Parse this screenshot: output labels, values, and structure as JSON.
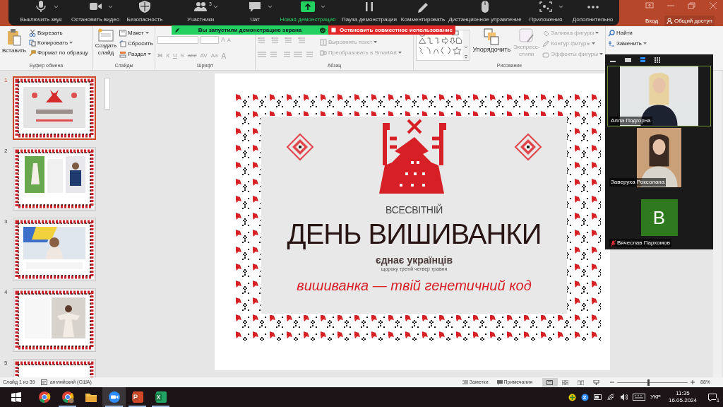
{
  "powerpoint": {
    "sign_in": "Вход",
    "share": "Общий доступ"
  },
  "zoom_toolbar": {
    "items": [
      {
        "label": "Выключить звук",
        "has_menu": true,
        "active": false
      },
      {
        "label": "Остановить видео",
        "has_menu": true,
        "active": false
      },
      {
        "label": "Безопасность",
        "has_menu": false,
        "active": false
      },
      {
        "label": "Участники",
        "count": "3",
        "has_menu": true,
        "active": false
      },
      {
        "label": "Чат",
        "has_menu": true,
        "active": false
      },
      {
        "label": "Новая демонстрация",
        "has_menu": true,
        "active": true
      },
      {
        "label": "Пауза демонстрации",
        "has_menu": false,
        "active": false
      },
      {
        "label": "Комментировать",
        "has_menu": false,
        "active": false
      },
      {
        "label": "Дистанционное управление",
        "has_menu": false,
        "active": false
      },
      {
        "label": "Приложения",
        "has_menu": true,
        "active": false
      },
      {
        "label": "Дополнительно",
        "has_menu": false,
        "active": false
      }
    ]
  },
  "sharing_banner": {
    "message": "Вы запустили демонстрацию экрана",
    "stop_button": "Остановить совместное использование"
  },
  "ribbon": {
    "clipboard": {
      "label": "Буфер обмена",
      "paste": "Вставить",
      "cut": "Вырезать",
      "copy": "Копировать",
      "format_painter": "Формат по образцу"
    },
    "slides": {
      "label": "Слайды",
      "new_slide": "Создать слайд",
      "layout": "Макет",
      "reset": "Сбросить",
      "section": "Раздел"
    },
    "font": {
      "label": "Шрифт",
      "disabled": true,
      "grow": "A",
      "shrink": "A",
      "buttons": [
        "Ж",
        "К",
        "Ч",
        "S",
        "abc",
        "AV",
        "Aa",
        "A"
      ]
    },
    "paragraph": {
      "label": "Абзац",
      "disabled": true,
      "align_text": "Выровнять текст",
      "smartart": "Преобразовать в SmartArt"
    },
    "drawing": {
      "label": "Рисование",
      "items": [
        {
          "label": "Упорядочить",
          "disabled": false
        },
        {
          "label": "Экспресс-стили",
          "disabled": true
        },
        {
          "label": "Заливка фигуры",
          "disabled": true
        },
        {
          "label": "Контур фигуры",
          "disabled": true
        },
        {
          "label": "Эффекты фигуры",
          "disabled": true
        }
      ]
    },
    "editing": {
      "find": "Найти",
      "replace": "Заменить"
    }
  },
  "slides_panel": {
    "slides": [
      {
        "number": "1",
        "selected": true
      },
      {
        "number": "2",
        "selected": false
      },
      {
        "number": "3",
        "selected": false
      },
      {
        "number": "4",
        "selected": false
      },
      {
        "number": "5",
        "selected": false
      }
    ]
  },
  "slide": {
    "overline": "ВСЕСВІТНІЙ",
    "title": "ДЕНЬ ВИШИВАНКИ",
    "tagline": "єднає українців",
    "date_note": "щороку третій четвер травня",
    "slogan": "вишиванка — твій генетичний код"
  },
  "video_panel": {
    "view_modes": [
      {
        "selected": false
      },
      {
        "selected": false
      },
      {
        "selected": true
      },
      {
        "selected": false
      }
    ],
    "participants": [
      {
        "name": "Алла Подгорна",
        "kind": "video",
        "speaking": true,
        "muted": false
      },
      {
        "name": "Заверуха Роксолана",
        "kind": "video",
        "speaking": false,
        "muted": false
      },
      {
        "name": "Вячеслав Пархомов",
        "kind": "avatar",
        "initial": "B",
        "speaking": false,
        "muted": true
      }
    ]
  },
  "status_bar": {
    "slide_counter": "Слайд 1 из 39",
    "language": "английский (США)",
    "notes": "Заметки",
    "comments": "Примечания",
    "views": [
      {
        "selected": true
      },
      {
        "selected": false
      },
      {
        "selected": false
      },
      {
        "selected": false
      }
    ],
    "zoom": "88%",
    "zoom_slider": {
      "level": 0.45
    }
  },
  "taskbar": {
    "apps": [
      {
        "selected": false,
        "running": false
      },
      {
        "selected": false,
        "running": true
      },
      {
        "selected": false,
        "running": false
      },
      {
        "selected": true,
        "running": true
      },
      {
        "selected": false,
        "running": true
      },
      {
        "selected": false,
        "running": true
      }
    ],
    "language": "УКР",
    "time": "11:35",
    "date": "16.05.2024",
    "notifications": "1"
  }
}
